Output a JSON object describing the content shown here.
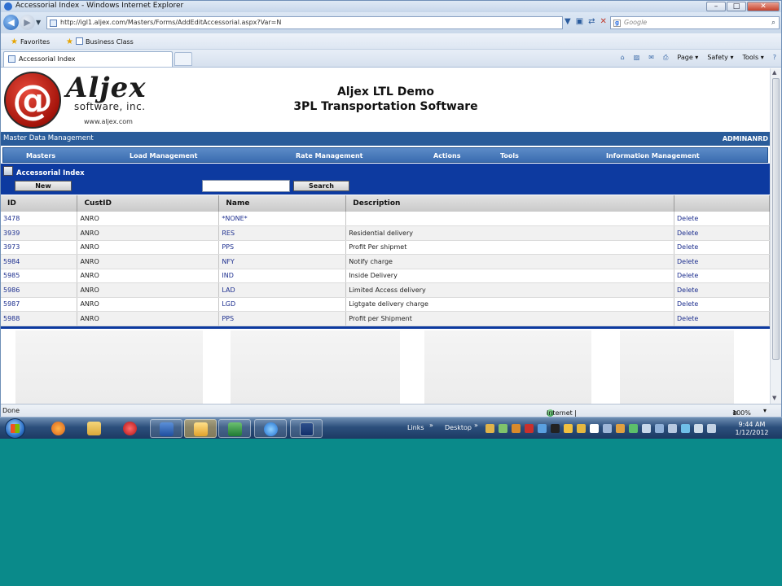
{
  "window": {
    "title": "Accessorial Index - Windows Internet Explorer",
    "minimize": "–",
    "maximize": "□",
    "close": "✕"
  },
  "address": {
    "url": "http://igl1.aljex.com/Masters/Forms/AddEditAccessorial.aspx?Var=N",
    "search_placeholder": "Google",
    "back": "◀",
    "forward": "▶",
    "dropdown": "▼",
    "go_icons": [
      "▼",
      "▣",
      "⇄",
      "✕"
    ],
    "search_icon": "⌕"
  },
  "favorites": {
    "favorites_label": "Favorites",
    "link_label": "Business Class"
  },
  "tab": {
    "active_label": "Accessorial Index"
  },
  "commandbar": {
    "items": [
      "Page ▾",
      "Safety ▾",
      "Tools ▾"
    ],
    "icons": [
      "⌂",
      "▨",
      "✉",
      "⎙"
    ]
  },
  "header": {
    "logo_glyph": "@",
    "brand_name": "Aljex",
    "brand_sub": "software, inc.",
    "brand_web": "www.aljex.com",
    "title_line1": "Aljex LTL Demo",
    "title_line2": "3PL Transportation Software"
  },
  "mdm": {
    "label": "Master Data Management",
    "user": "ADMINANRD"
  },
  "menu": {
    "items": [
      "Masters",
      "Load Management",
      "Rate Management",
      "Actions",
      "Tools",
      "Information Management"
    ]
  },
  "panel": {
    "title": "Accessorial Index",
    "new_label": "New",
    "search_label": "Search",
    "search_value": ""
  },
  "grid": {
    "columns": [
      "ID",
      "CustID",
      "Name",
      "Description",
      ""
    ],
    "rows": [
      {
        "id": "3478",
        "cust": "ANRO",
        "name": "*NONE*",
        "desc": "",
        "action": "Delete"
      },
      {
        "id": "3939",
        "cust": "ANRO",
        "name": "RES",
        "desc": "Residential delivery",
        "action": "Delete"
      },
      {
        "id": "3973",
        "cust": "ANRO",
        "name": "PPS",
        "desc": "Profit Per shipmet",
        "action": "Delete"
      },
      {
        "id": "5984",
        "cust": "ANRO",
        "name": "NFY",
        "desc": "Notify charge",
        "action": "Delete"
      },
      {
        "id": "5985",
        "cust": "ANRO",
        "name": "IND",
        "desc": "Inside Delivery",
        "action": "Delete"
      },
      {
        "id": "5986",
        "cust": "ANRO",
        "name": "LAD",
        "desc": "Limited Access delivery",
        "action": "Delete"
      },
      {
        "id": "5987",
        "cust": "ANRO",
        "name": "LGD",
        "desc": "Ligtgate delivery charge",
        "action": "Delete"
      },
      {
        "id": "5988",
        "cust": "ANRO",
        "name": "PPS",
        "desc": "Profit per Shipment",
        "action": "Delete"
      }
    ]
  },
  "status": {
    "left": "Done",
    "zone": "Internet | Protected Mode: On",
    "zoom": "100%",
    "zoom_arrow": "▾"
  },
  "taskbar": {
    "links": "Links",
    "desktop": "Desktop",
    "chevron": "»",
    "time": "9:44 AM",
    "date": "1/12/2012"
  },
  "colors": {
    "menu_blue": "#3a6cb0",
    "panel_blue": "#0d3aa0",
    "link_blue": "#1d2f8f",
    "desktop_teal": "#0a8a8a"
  }
}
